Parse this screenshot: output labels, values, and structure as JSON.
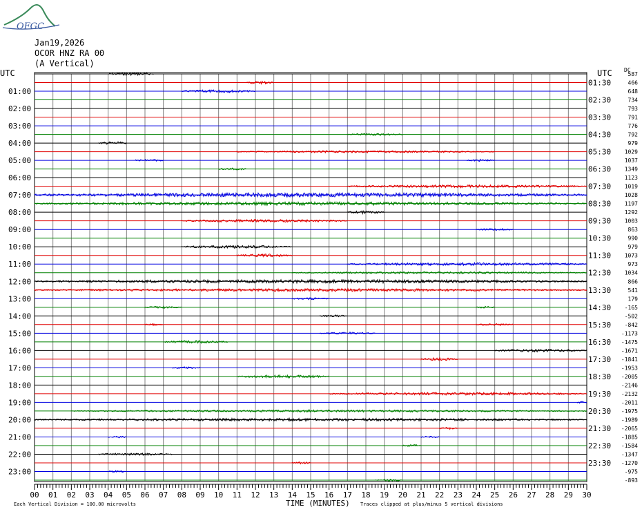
{
  "logo": {
    "text": "OFGC",
    "icon": "mountain-swoosh-logo"
  },
  "header": {
    "date": "Jan19,2026",
    "station": "OCOR HNZ RA 00",
    "component": "(A Vertical)"
  },
  "colors": {
    "grid": "#808080",
    "trace_cycle": [
      "#000000",
      "#e00000",
      "#0000e0",
      "#008000"
    ]
  },
  "chart_data": {
    "type": "helicorder",
    "left_axis_title": "UTC",
    "right_axis_title": "UTC",
    "dc_header": "DC",
    "left_labels": [
      "01:00",
      "02:00",
      "03:00",
      "04:00",
      "05:00",
      "06:00",
      "07:00",
      "08:00",
      "09:00",
      "10:00",
      "11:00",
      "12:00",
      "13:00",
      "14:00",
      "15:00",
      "16:00",
      "17:00",
      "18:00",
      "19:00",
      "20:00",
      "21:00",
      "22:00",
      "23:00"
    ],
    "right_labels": [
      "01:30",
      "02:30",
      "03:30",
      "04:30",
      "05:30",
      "06:30",
      "07:30",
      "08:30",
      "09:30",
      "10:30",
      "11:30",
      "12:30",
      "13:30",
      "14:30",
      "15:30",
      "16:30",
      "17:30",
      "18:30",
      "19:30",
      "20:30",
      "21:30",
      "22:30",
      "23:30"
    ],
    "dc_offsets": [
      "587",
      "466",
      "648",
      "734",
      "793",
      "791",
      "776",
      "792",
      "979",
      "1029",
      "1037",
      "1349",
      "1123",
      "1019",
      "1028",
      "1197",
      "1292",
      "1003",
      "863",
      "990",
      "979",
      "1073",
      "973",
      "1034",
      "866",
      "541",
      "179",
      "-165",
      "-502",
      "-842",
      "-1173",
      "-1475",
      "-1671",
      "-1841",
      "-1953",
      "-2005",
      "-2146",
      "-2132",
      "-2011",
      "-1975",
      "-1989",
      "-2065",
      "-1885",
      "-1584",
      "-1347",
      "-1270",
      "-975",
      "-893"
    ],
    "x_ticks": [
      "00",
      "01",
      "02",
      "03",
      "04",
      "05",
      "06",
      "07",
      "08",
      "09",
      "10",
      "11",
      "12",
      "13",
      "14",
      "15",
      "16",
      "17",
      "18",
      "19",
      "20",
      "21",
      "22",
      "23",
      "24",
      "25",
      "26",
      "27",
      "28",
      "29",
      "30"
    ],
    "xlim": [
      0,
      30
    ],
    "xlabel": "TIME (MINUTES)",
    "footer_left": "Each Vertical Division =  100.00 microvolts",
    "footer_right": "Traces clipped at plus/minus 5 vertical divisions",
    "rows": 48,
    "activity": [
      {
        "row": 0,
        "start": 4,
        "end": 6.5,
        "amp": 2
      },
      {
        "row": 1,
        "start": 11.5,
        "end": 13,
        "amp": 2
      },
      {
        "row": 2,
        "start": 8,
        "end": 12,
        "amp": 2
      },
      {
        "row": 7,
        "start": 17,
        "end": 20,
        "amp": 1.5
      },
      {
        "row": 8,
        "start": 3.5,
        "end": 5,
        "amp": 2
      },
      {
        "row": 9,
        "start": 11,
        "end": 25,
        "amp": 1.5
      },
      {
        "row": 10,
        "start": 5.5,
        "end": 7,
        "amp": 1.5
      },
      {
        "row": 10,
        "start": 23.5,
        "end": 25,
        "amp": 1.5
      },
      {
        "row": 11,
        "start": 10,
        "end": 11.5,
        "amp": 1.5
      },
      {
        "row": 13,
        "start": 17,
        "end": 30,
        "amp": 2
      },
      {
        "row": 14,
        "start": 0,
        "end": 30,
        "amp": 3
      },
      {
        "row": 15,
        "start": 0,
        "end": 30,
        "amp": 2.5
      },
      {
        "row": 16,
        "start": 17,
        "end": 19,
        "amp": 2
      },
      {
        "row": 17,
        "start": 8,
        "end": 17,
        "amp": 2
      },
      {
        "row": 18,
        "start": 24,
        "end": 26,
        "amp": 1.5
      },
      {
        "row": 20,
        "start": 8,
        "end": 14,
        "amp": 2
      },
      {
        "row": 21,
        "start": 11,
        "end": 14,
        "amp": 2
      },
      {
        "row": 22,
        "start": 17,
        "end": 30,
        "amp": 2
      },
      {
        "row": 23,
        "start": 14,
        "end": 30,
        "amp": 1.5
      },
      {
        "row": 24,
        "start": 0,
        "end": 30,
        "amp": 2.5
      },
      {
        "row": 25,
        "start": 0,
        "end": 30,
        "amp": 2
      },
      {
        "row": 26,
        "start": 14,
        "end": 16,
        "amp": 1.5
      },
      {
        "row": 27,
        "start": 6,
        "end": 8,
        "amp": 1.5
      },
      {
        "row": 27,
        "start": 24,
        "end": 25,
        "amp": 1.5
      },
      {
        "row": 28,
        "start": 15.5,
        "end": 17,
        "amp": 1.5
      },
      {
        "row": 29,
        "start": 6,
        "end": 7,
        "amp": 1.5
      },
      {
        "row": 29,
        "start": 24,
        "end": 26,
        "amp": 1.5
      },
      {
        "row": 30,
        "start": 15.5,
        "end": 18.5,
        "amp": 1.5
      },
      {
        "row": 31,
        "start": 7,
        "end": 10.5,
        "amp": 2
      },
      {
        "row": 32,
        "start": 25,
        "end": 30,
        "amp": 2
      },
      {
        "row": 33,
        "start": 21,
        "end": 23,
        "amp": 2
      },
      {
        "row": 34,
        "start": 7.5,
        "end": 9,
        "amp": 1.5
      },
      {
        "row": 35,
        "start": 11,
        "end": 16,
        "amp": 2
      },
      {
        "row": 37,
        "start": 16,
        "end": 30,
        "amp": 2
      },
      {
        "row": 38,
        "start": 29.5,
        "end": 30,
        "amp": 1.5
      },
      {
        "row": 39,
        "start": 2,
        "end": 30,
        "amp": 1.5
      },
      {
        "row": 40,
        "start": 0,
        "end": 30,
        "amp": 2
      },
      {
        "row": 41,
        "start": 22,
        "end": 23,
        "amp": 1.5
      },
      {
        "row": 42,
        "start": 4,
        "end": 5,
        "amp": 1.5
      },
      {
        "row": 42,
        "start": 21,
        "end": 22,
        "amp": 1.5
      },
      {
        "row": 43,
        "start": 20,
        "end": 21,
        "amp": 1.5
      },
      {
        "row": 44,
        "start": 3.5,
        "end": 7.5,
        "amp": 1.5
      },
      {
        "row": 45,
        "start": 14,
        "end": 15,
        "amp": 1.5
      },
      {
        "row": 46,
        "start": 4,
        "end": 5,
        "amp": 1.5
      },
      {
        "row": 47,
        "start": 18.5,
        "end": 20,
        "amp": 1.5
      }
    ]
  }
}
